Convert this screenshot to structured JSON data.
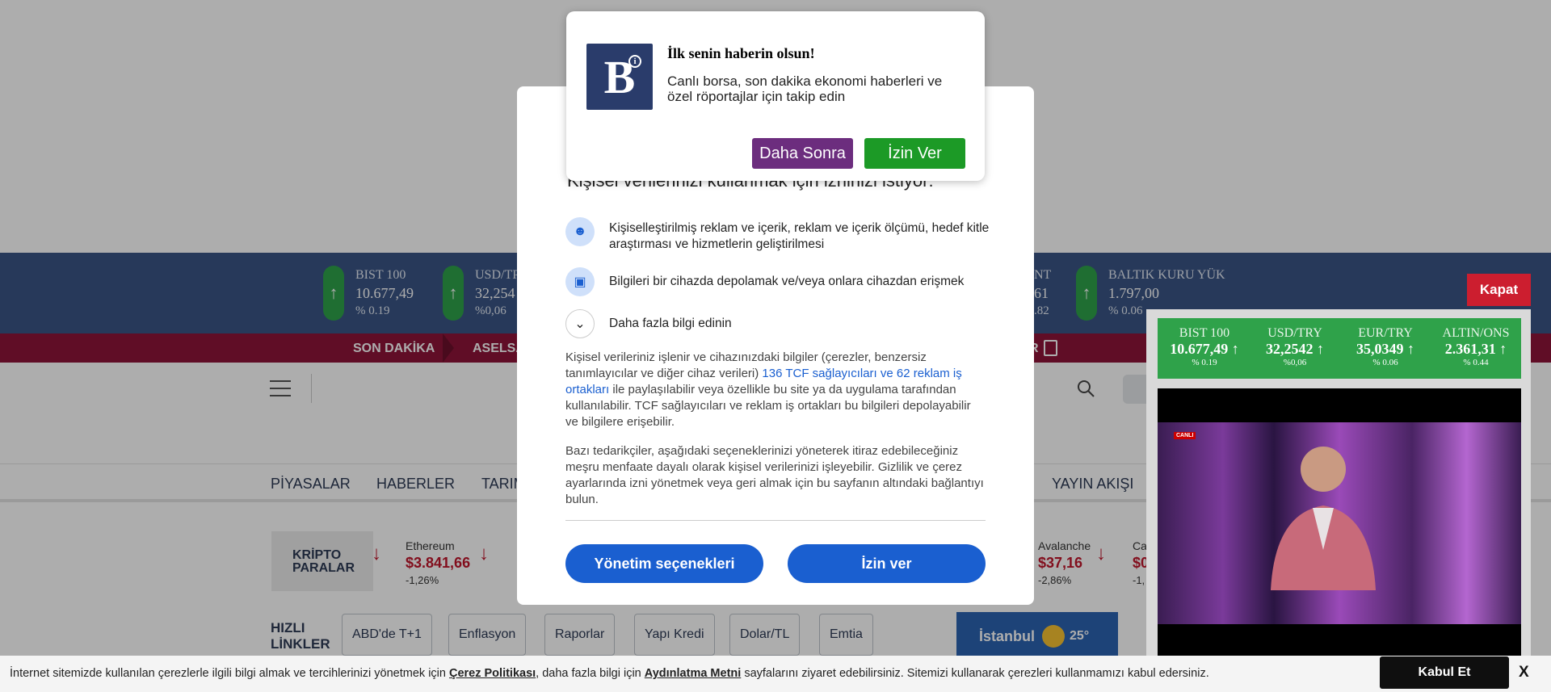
{
  "ticker": [
    {
      "name": "BIST 100",
      "value": "10.677,49",
      "change": "% 0.19"
    },
    {
      "name": "USD/TR",
      "value": "32,254",
      "change": "%0,06"
    },
    {
      "name": "NT",
      "value": "61",
      "change": ".82"
    },
    {
      "name": "BALTIK KURU YÜK",
      "value": "1.797,00",
      "change": "% 0.06"
    }
  ],
  "news": {
    "label": "SON DAKİKA",
    "item": "ASELSA",
    "item2": "R"
  },
  "nav": [
    "PİYASALAR",
    "HABERLER",
    "TARIM",
    "YAYIN AKIŞI"
  ],
  "crypto": {
    "label_line1": "KRİPTO",
    "label_line2": "PARALAR",
    "items": [
      {
        "name": "Ethereum",
        "value": "$3.841,66",
        "change": "-1,26%"
      },
      {
        "name": "Avalanche",
        "value": "$37,16",
        "change": "-2,86%"
      },
      {
        "name": "Ca",
        "value": "$0",
        "change": "-1,"
      }
    ]
  },
  "quick": {
    "title_line1": "HIZLI",
    "title_line2": "LİNKLER",
    "links": [
      "ABD'de T+1",
      "Enflasyon",
      "Raporlar",
      "Yapı Kredi",
      "Dolar/TL",
      "Emtia"
    ]
  },
  "weather": {
    "city": "İstanbul",
    "temp": "25°"
  },
  "consent": {
    "title_partial": "Kişisel verilerinizi kullanmak için izninizi istiyor:",
    "purpose1": "Kişiselleştirilmiş reklam ve içerik, reklam ve içerik ölçümü, hedef kitle araştırması ve hizmetlerin geliştirilmesi",
    "purpose2": "Bilgileri bir cihazda depolamak ve/veya onlara cihazdan erişmek",
    "more_info": "Daha fazla bilgi edinin",
    "para1_a": "Kişisel verileriniz işlenir ve cihazınızdaki bilgiler (çerezler, benzersiz tanımlayıcılar ve diğer cihaz verileri) ",
    "para1_link": "136 TCF sağlayıcıları ve 62 reklam iş ortakları",
    "para1_b": " ile paylaşılabilir veya özellikle bu site ya da uygulama tarafından kullanılabilir. TCF sağlayıcıları ve reklam iş ortakları bu bilgileri depolayabilir ve bilgilere erişebilir.",
    "para2": "Bazı tedarikçiler, aşağıdaki seçeneklerinizi yöneterek itiraz edebileceğiniz meşru menfaate dayalı olarak kişisel verilerinizi işleyebilir. Gizlilik ve çerez ayarlarında izni yönetmek veya geri almak için bu sayfanın altındaki bağlantıyı bulun.",
    "manage_label": "Yönetim seçenekleri",
    "accept_label": "İzin ver"
  },
  "push": {
    "logo_letter": "B",
    "title": "İlk senin haberin olsun!",
    "body": "Canlı borsa, son dakika ekonomi haberleri ve özel röportajlar için takip edin",
    "later_label": "Daha Sonra",
    "allow_label": "İzin Ver"
  },
  "player": {
    "close_label": "Kapat",
    "live_badge": "CANLI",
    "mini_ticker": [
      {
        "name": "BIST 100",
        "value": "10.677,49",
        "change": "% 0.19"
      },
      {
        "name": "USD/TRY",
        "value": "32,2542",
        "change": "%0,06"
      },
      {
        "name": "EUR/TRY",
        "value": "35,0349",
        "change": "% 0.06"
      },
      {
        "name": "ALTIN/ONS",
        "value": "2.361,31",
        "change": "% 0.44"
      }
    ]
  },
  "cookie": {
    "text_a": "İnternet sitemizde kullanılan çerezlerle ilgili bilgi almak ve tercihlerinizi yönetmek için ",
    "policy_link": "Çerez Politikası",
    "text_b": ", daha fazla bilgi için ",
    "notice_link": "Aydınlatma Metni",
    "text_c": " sayfalarını ziyaret edebilirsiniz. Sitemizi kullanarak çerezleri kullanmamızı kabul edersiniz.",
    "accept_label": "Kabul Et",
    "close_label": "X"
  },
  "colors": {
    "ticker_bg": "#3a5585",
    "up_green": "#2fa24a",
    "news_bg": "#8e1438",
    "down_red": "#c0162c",
    "consent_btn": "#1a5fd0"
  }
}
